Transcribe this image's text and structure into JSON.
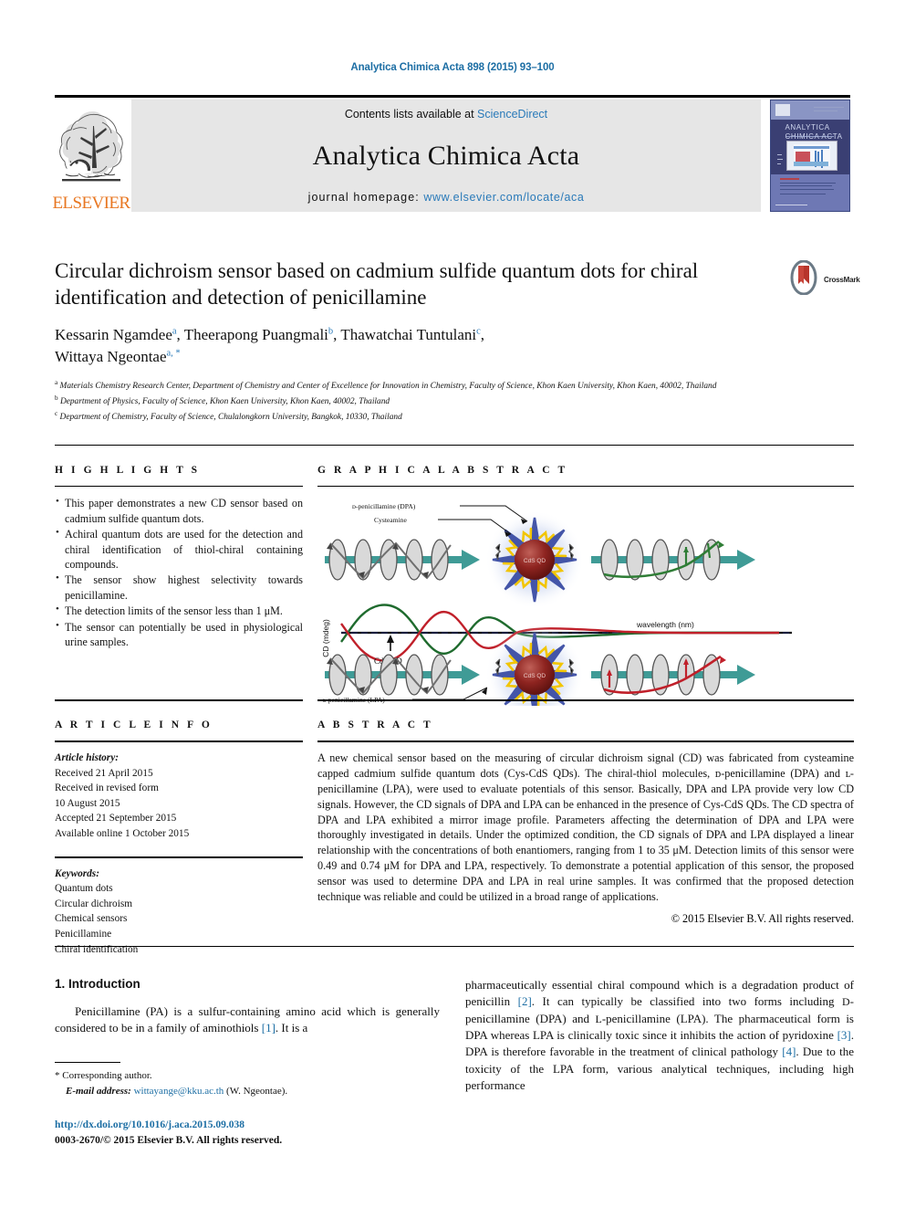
{
  "running_head": "Analytica Chimica Acta 898 (2015) 93–100",
  "masthead": {
    "contents_prefix": "Contents lists available at ",
    "contents_link": "ScienceDirect",
    "journal_name": "Analytica Chimica Acta",
    "homepage_prefix": "journal homepage: ",
    "homepage_url": "www.elsevier.com/locate/aca",
    "publisher": "ELSEVIER",
    "cover_title_line1": "ANALYTICA",
    "cover_title_line2": "CHIMICA ACTA"
  },
  "crossmark": {
    "label": "CrossMark"
  },
  "article": {
    "title": "Circular dichroism sensor based on cadmium sulfide quantum dots for chiral identification and detection of penicillamine",
    "authors_line1_a": "Kessarin Ngamdee",
    "authors_line1_a_sup": "a",
    "authors_line1_b": "Theerapong Puangmali",
    "authors_line1_b_sup": "b",
    "authors_line1_c": "Thawatchai Tuntulani",
    "authors_line1_c_sup": "c",
    "authors_line2": "Wittaya Ngeontae",
    "authors_line2_sup": "a, *",
    "affiliations": [
      {
        "mark": "a",
        "text": "Materials Chemistry Research Center, Department of Chemistry and Center of Excellence for Innovation in Chemistry, Faculty of Science, Khon Kaen University, Khon Kaen, 40002, Thailand"
      },
      {
        "mark": "b",
        "text": "Department of Physics, Faculty of Science, Khon Kaen University, Khon Kaen, 40002, Thailand"
      },
      {
        "mark": "c",
        "text": "Department of Chemistry, Faculty of Science, Chulalongkorn University, Bangkok, 10330, Thailand"
      }
    ]
  },
  "highlights": {
    "heading": "H I G H L I G H T S",
    "items": [
      "This paper demonstrates a new CD sensor based on cadmium sulfide quantum dots.",
      "Achiral quantum dots are used for the detection and chiral identification of thiol-chiral containing compounds.",
      "The sensor show highest selectivity towards penicillamine.",
      "The detection limits of the sensor less than 1 μM.",
      "The sensor can potentially be used in physiological urine samples."
    ]
  },
  "graphical_abstract": {
    "heading": "G R A P H I C A L   A B S T R A C T",
    "label_dpa": "ᴅ-penicillamine (DPA)",
    "label_cysteamine": "Cysteamine",
    "label_lpa": "ʟ-penicillamine (LPA)",
    "label_qd": "CdS QD",
    "label_qd_core": "CdS QD",
    "axis_y": "CD (mdeg)",
    "axis_x": "wavelength (nm)",
    "colors": {
      "dpa_curve": "#1f6b2e",
      "lpa_curve": "#c0202a",
      "beam": "#3f9b96",
      "qd_core": "#8e2420",
      "spike_blue": "#4455a8",
      "spike_yellow": "#f2c500"
    }
  },
  "article_info": {
    "heading": "A R T I C L E   I N F O",
    "history_label": "Article history:",
    "history": [
      "Received 21 April 2015",
      "Received in revised form",
      "10 August 2015",
      "Accepted 21 September 2015",
      "Available online 1 October 2015"
    ],
    "keywords_label": "Keywords:",
    "keywords": [
      "Quantum dots",
      "Circular dichroism",
      "Chemical sensors",
      "Penicillamine",
      "Chiral identification"
    ]
  },
  "abstract": {
    "heading": "A B S T R A C T",
    "text": "A new chemical sensor based on the measuring of circular dichroism signal (CD) was fabricated from cysteamine capped cadmium sulfide quantum dots (Cys-CdS QDs). The chiral-thiol molecules, ᴅ-penicillamine (DPA) and ʟ-penicillamine (LPA), were used to evaluate potentials of this sensor. Basically, DPA and LPA provide very low CD signals. However, the CD signals of DPA and LPA can be enhanced in the presence of Cys-CdS QDs. The CD spectra of DPA and LPA exhibited a mirror image profile. Parameters affecting the determination of DPA and LPA were thoroughly investigated in details. Under the optimized condition, the CD signals of DPA and LPA displayed a linear relationship with the concentrations of both enantiomers, ranging from 1 to 35 μM. Detection limits of this sensor were 0.49 and 0.74 μM for DPA and LPA, respectively. To demonstrate a potential application of this sensor, the proposed sensor was used to determine DPA and LPA in real urine samples. It was confirmed that the proposed detection technique was reliable and could be utilized in a broad range of applications.",
    "copyright": "© 2015 Elsevier B.V. All rights reserved."
  },
  "introduction": {
    "section_number_title": "1. Introduction",
    "left_paragraph": "Penicillamine (PA) is a sulfur-containing amino acid which is generally considered to be in a family of aminothiols [1]. It is a",
    "left_ref": "[1]",
    "right_paragraph": "pharmaceutically essential chiral compound which is a degradation product of penicillin [2]. It can typically be classified into two forms including ᴅ-penicillamine (DPA) and ʟ-penicillamine (LPA). The pharmaceutical form is DPA whereas LPA is clinically toxic since it inhibits the action of pyridoxine [3]. DPA is therefore favorable in the treatment of clinical pathology [4]. Due to the toxicity of the LPA form, various analytical techniques, including high performance"
  },
  "footnote": {
    "star": "*",
    "corresponding": "Corresponding author.",
    "email_label": "E-mail address:",
    "email": "wittayange@kku.ac.th",
    "email_owner": "(W. Ngeontae)."
  },
  "footer": {
    "doi": "http://dx.doi.org/10.1016/j.aca.2015.09.038",
    "issn_line": "0003-2670/© 2015 Elsevier B.V. All rights reserved."
  }
}
